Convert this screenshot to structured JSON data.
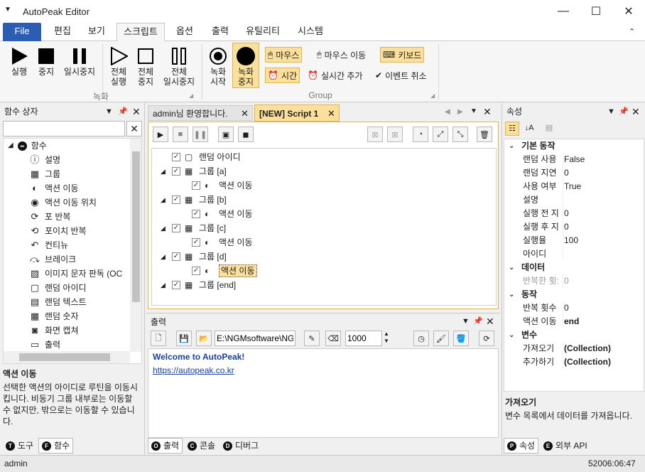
{
  "app": {
    "title": "AutoPeak Editor"
  },
  "menu": {
    "file": "File",
    "tabs": [
      "편집",
      "보기",
      "스크립트",
      "옵션",
      "출력",
      "유틸리티",
      "시스템"
    ],
    "active_tab": "스크립트"
  },
  "ribbon": {
    "run": "실행",
    "stop": "중지",
    "pause": "일시중지",
    "run_all": "전체\n실행",
    "stop_all": "전체\n중지",
    "pause_all": "전체\n일시중지",
    "rec_start": "녹화\n시작",
    "rec_stop": "녹화\n중지",
    "mouse_click": "마우스",
    "mouse_move": "마우스 이동",
    "keyboard": "키보드",
    "time": "시간",
    "realtime_add": "실시간 추가",
    "event_cancel": "이벤트 취소",
    "group_record": "녹화",
    "group_group": "Group"
  },
  "function_box": {
    "title": "함수 상자",
    "search_value": "",
    "root": "함수",
    "items": [
      "설명",
      "그룹",
      "액션 이동",
      "액션 이동 위치",
      "포 반복",
      "포이치 반복",
      "컨티뉴",
      "브레이크",
      "이미지 문자 판독 (OC",
      "랜덤 아이디",
      "랜덤 텍스트",
      "랜덤 숫자",
      "화면 캡쳐",
      "출력"
    ],
    "desc_title": "액션 이동",
    "desc_text": "선택한 액션의 아이디로 루틴을 이동시킵니다. 비동기 그룹 내부로는 이동할 수 없지만, 밖으로는 이동할 수 있습니다.",
    "tabs": [
      "도구",
      "함수"
    ]
  },
  "doc_tabs": [
    "admin님 환영합니다.",
    "[NEW] Script 1"
  ],
  "script_tree": [
    {
      "label": "랜덤 아이디",
      "level": 0,
      "icon": "random-id"
    },
    {
      "label": "그룹 [a]",
      "level": 0,
      "icon": "group"
    },
    {
      "label": "액션 이동",
      "level": 1,
      "icon": "action"
    },
    {
      "label": "그룹 [b]",
      "level": 0,
      "icon": "group"
    },
    {
      "label": "액션 이동",
      "level": 1,
      "icon": "action"
    },
    {
      "label": "그룹 [c]",
      "level": 0,
      "icon": "group"
    },
    {
      "label": "액션 이동",
      "level": 1,
      "icon": "action"
    },
    {
      "label": "그룹 [d]",
      "level": 0,
      "icon": "group"
    },
    {
      "label": "액션 이동",
      "level": 1,
      "icon": "action",
      "selected": true
    },
    {
      "label": "그룹 [end]",
      "level": 0,
      "icon": "group"
    }
  ],
  "output": {
    "title": "출력",
    "path": "E:\\NGMsoftware\\NG",
    "count": "1000",
    "lines": [
      "Welcome to AutoPeak!",
      "https://autopeak.co.kr"
    ],
    "tabs": [
      "출력",
      "콘솔",
      "디버그"
    ]
  },
  "properties": {
    "title": "속성",
    "cat_basic": "기본 동작",
    "rows_basic": [
      [
        "랜덤 사용",
        "False"
      ],
      [
        "랜덤 지연",
        "0"
      ],
      [
        "사용 여부",
        "True"
      ],
      [
        "설명",
        ""
      ],
      [
        "실행 전 지",
        "0"
      ],
      [
        "실행 후 지",
        "0"
      ],
      [
        "실행율",
        "100"
      ],
      [
        "아이디",
        ""
      ]
    ],
    "cat_data": "데이터",
    "rows_data": [
      [
        "반복한 횟:",
        "0"
      ]
    ],
    "cat_action": "동작",
    "rows_action": [
      [
        "반복 횟수",
        "0"
      ],
      [
        "액션 이동",
        "end"
      ]
    ],
    "cat_var": "변수",
    "rows_var": [
      [
        "가져오기",
        "(Collection)"
      ],
      [
        "추가하기",
        "(Collection)"
      ]
    ],
    "desc_title": "가져오기",
    "desc_text": "변수 목록에서 데이터를 가져옵니다.",
    "tabs": [
      "속성",
      "외부 API"
    ]
  },
  "status": {
    "user": "admin",
    "time": "52006:06:47"
  },
  "colors": {
    "accent": "#2b5eb3",
    "highlight": "#fbe09b",
    "link": "#1a3fa3"
  }
}
